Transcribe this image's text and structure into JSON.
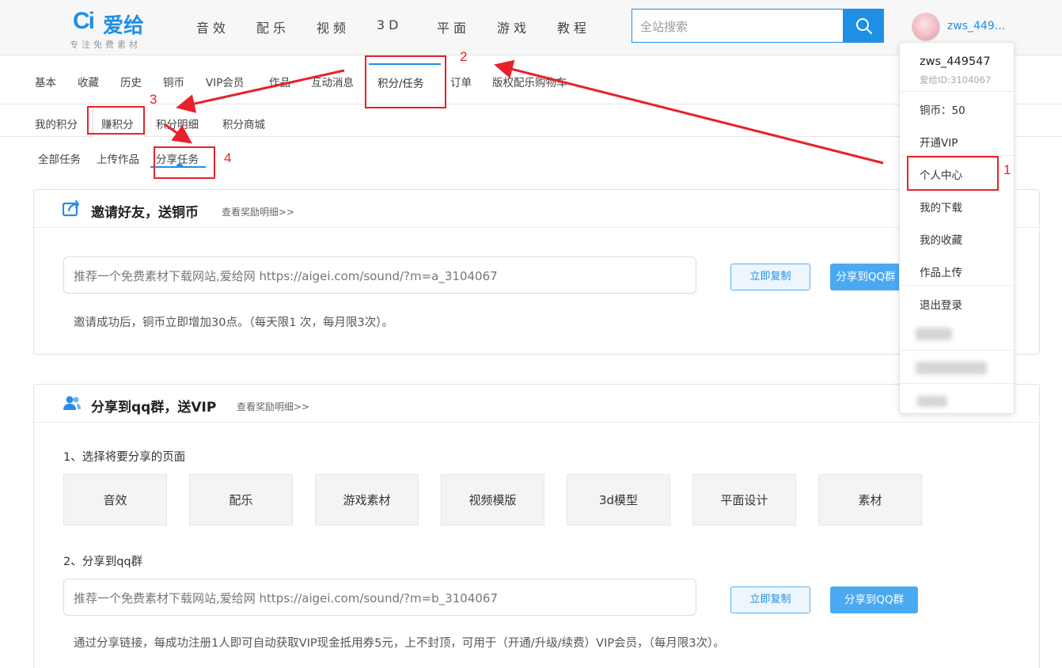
{
  "header": {
    "logo_mark": "Ci",
    "logo_text": "爱给",
    "logo_slogan": "专注免费素材",
    "nav": [
      "音效",
      "配乐",
      "视频",
      "3D",
      "平面",
      "游戏",
      "教程"
    ],
    "search_placeholder": "全站搜索",
    "username": "zws_449..."
  },
  "tabs_level1": [
    "基本",
    "收藏",
    "历史",
    "铜币",
    "VIP会员",
    "作品",
    "互动消息",
    "积分/任务",
    "订单",
    "版权配乐购物车"
  ],
  "tabs_level1_active": "积分/任务",
  "tabs_level2": [
    "我的积分",
    "赚积分",
    "积分明细",
    "积分商城"
  ],
  "tabs_level2_active": "赚积分",
  "tabs_level3": [
    "全部任务",
    "上传作品",
    "分享任务"
  ],
  "tabs_level3_active": "分享任务",
  "invite_panel": {
    "title": "邀请好友，送铜币",
    "detail_link": "查看奖励明细>>",
    "share_text": "推荐一个免费素材下载网站,爱给网   https://aigei.com/sound/?m=a_3104067",
    "copy_button": "立即复制",
    "share_button": "分享到QQ群",
    "note": "邀请成功后，铜币立即增加30点。（每天限1 次，每月限3次）。"
  },
  "qq_panel": {
    "title": "分享到qq群，送VIP",
    "detail_link": "查看奖励明细>>",
    "step1": "1、选择将要分享的页面",
    "options": [
      "音效",
      "配乐",
      "游戏素材",
      "视频模版",
      "3d模型",
      "平面设计",
      "素材"
    ],
    "step2": "2、分享到qq群",
    "share_text": "推荐一个免费素材下载网站,爱给网   https://aigei.com/sound/?m=b_3104067",
    "copy_button": "立即复制",
    "share_button": "分享到QQ群",
    "note": "通过分享链接，每成功注册1人即可自动获取VIP现金抵用券5元，上不封顶，可用于（开通/升级/续费）VIP会员，（每月限3次）。"
  },
  "user_menu": {
    "name": "zws_449547",
    "id": "爱给ID:3104067",
    "coins": "铜币：50",
    "items": [
      "开通VIP",
      "个人中心",
      "我的下载",
      "我的收藏",
      "作品上传",
      "退出登录"
    ]
  },
  "annotations": [
    "1",
    "2",
    "3",
    "4"
  ],
  "colors": {
    "accent": "#1f8fe6",
    "annotation": "#e8212b"
  }
}
